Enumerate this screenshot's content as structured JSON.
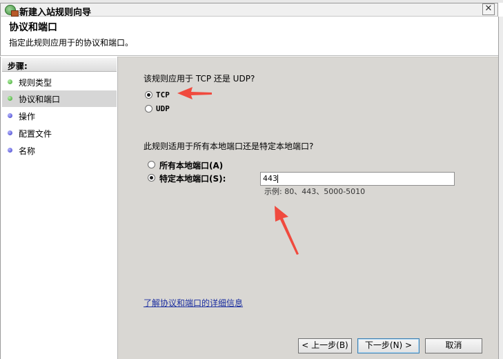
{
  "window": {
    "title": "新建入站规则向导",
    "close_glyph": "✕"
  },
  "header": {
    "title": "协议和端口",
    "subtitle": "指定此规则应用于的协议和端口。"
  },
  "sidebar": {
    "heading": "步骤:",
    "items": [
      {
        "label": "规则类型",
        "dot": "green"
      },
      {
        "label": "协议和端口",
        "dot": "green"
      },
      {
        "label": "操作",
        "dot": "blue"
      },
      {
        "label": "配置文件",
        "dot": "blue"
      },
      {
        "label": "名称",
        "dot": "blue"
      }
    ]
  },
  "protocol": {
    "question": "该规则应用于 TCP 还是 UDP?",
    "options": [
      {
        "label": "TCP",
        "checked": true
      },
      {
        "label": "UDP",
        "checked": false
      }
    ]
  },
  "ports": {
    "question": "此规则适用于所有本地端口还是特定本地端口?",
    "options": [
      {
        "label": "所有本地端口(A)",
        "checked": false
      },
      {
        "label": "特定本地端口(S):",
        "checked": true
      }
    ],
    "value": "443",
    "example": "示例: 80、443、5000-5010"
  },
  "help_link": "了解协议和端口的详细信息",
  "buttons": {
    "back": "< 上一步(B)",
    "next": "下一步(N) >",
    "cancel": "取消"
  },
  "colors": {
    "annotation_arrow": "#f04a3e",
    "content_bg": "#d9d7d3",
    "link": "#1b2ea0"
  }
}
